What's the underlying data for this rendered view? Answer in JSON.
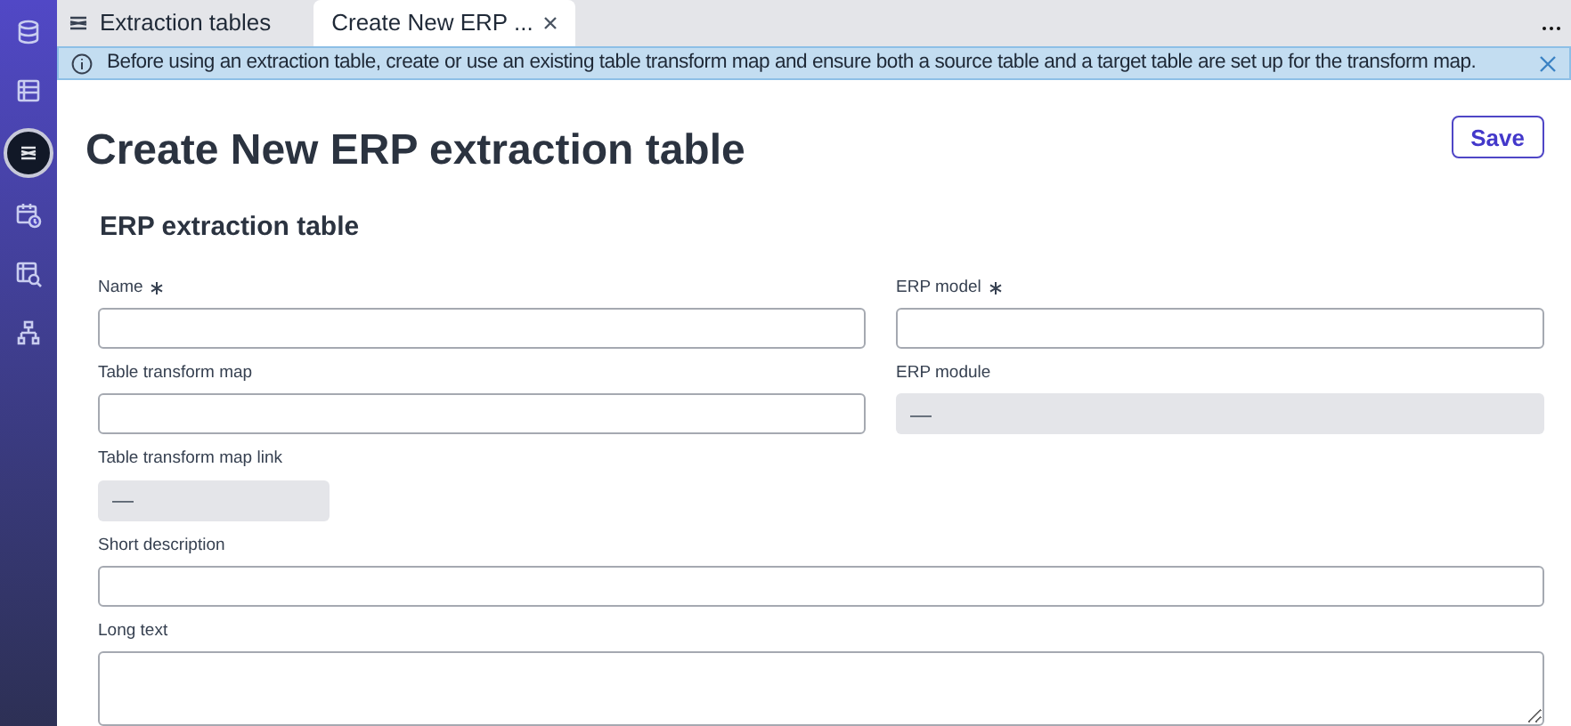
{
  "sidebar": {
    "items": [
      {
        "selected": false
      },
      {
        "selected": false
      },
      {
        "selected": true
      },
      {
        "selected": false
      },
      {
        "selected": false
      },
      {
        "selected": false
      }
    ]
  },
  "tabs": [
    {
      "label": "Extraction tables",
      "selected": false,
      "closable": false
    },
    {
      "label": "Create New ERP ...",
      "selected": true,
      "closable": true
    }
  ],
  "banner": {
    "text": "Before using an extraction table, create or use an existing table transform map and ensure both a source table and a target table are set up for the transform map."
  },
  "page_title": "Create New ERP extraction table",
  "save_button": "Save",
  "section_title": "ERP extraction table",
  "grid_rows": [
    [
      {
        "label": "Name",
        "required": true,
        "kind": "input"
      },
      {
        "label": "ERP model",
        "required": true,
        "kind": "input"
      }
    ],
    [
      {
        "label": "Table transform map",
        "kind": "input"
      },
      {
        "label": "ERP module",
        "kind": "readonly",
        "value": "—"
      }
    ],
    [
      {
        "label": "Table transform map link",
        "kind": "link",
        "value": "—"
      }
    ]
  ],
  "wide_fields": [
    {
      "label": "Short description",
      "kind": "input"
    },
    {
      "label": "Long text",
      "kind": "textarea"
    }
  ]
}
